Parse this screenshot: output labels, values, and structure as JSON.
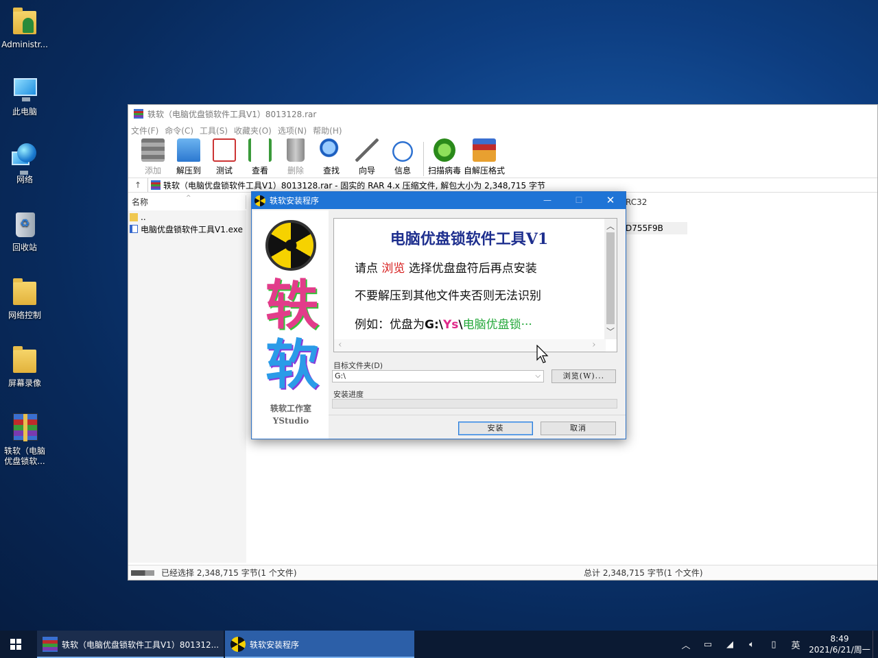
{
  "desktop": {
    "icons": [
      {
        "label": "Administr...",
        "type": "user-folder"
      },
      {
        "label": "此电脑",
        "type": "computer"
      },
      {
        "label": "网络",
        "type": "network"
      },
      {
        "label": "回收站",
        "type": "recycle-bin"
      },
      {
        "label": "网络控制",
        "type": "folder"
      },
      {
        "label": "屏幕录像",
        "type": "folder"
      },
      {
        "label": "轶软（电脑优盘锁软...",
        "type": "rar-archive"
      }
    ]
  },
  "winrar": {
    "title": "轶软（电脑优盘锁软件工具V1）8013128.rar",
    "menu": [
      "文件(F)",
      "命令(C)",
      "工具(S)",
      "收藏夹(O)",
      "选项(N)",
      "帮助(H)"
    ],
    "toolbar": {
      "add": "添加",
      "extract": "解压到",
      "test": "测试",
      "view": "查看",
      "delete": "删除",
      "find": "查找",
      "wizard": "向导",
      "info": "信息",
      "virus": "扫描病毒",
      "sfx": "自解压格式"
    },
    "address": "轶软（电脑优盘锁软件工具V1）8013128.rar - 固实的 RAR 4.x 压缩文件, 解包大小为 2,348,715 字节",
    "col_name": "名称",
    "col_crc": "RC32",
    "files": [
      {
        "name": ".."
      },
      {
        "name": "电脑优盘锁软件工具V1.exe",
        "crc": "D755F9B"
      }
    ],
    "status_left": "已经选择 2,348,715 字节(1 个文件)",
    "status_right": "总计 2,348,715 字节(1 个文件)"
  },
  "installer": {
    "title": "轶软安装程序",
    "brand_chars": [
      "轶",
      "软"
    ],
    "studio_cn": "轶软工作室",
    "studio_en": "YStudio",
    "heading": "电脑优盘锁软件工具V1",
    "line1_a": "请点",
    "line1_b": "浏览",
    "line1_c": "选择优盘盘符后再点安装",
    "line2": "不要解压到其他文件夹否则无法识别",
    "line3_a": "例如：优盘为",
    "line3_b": "G:\\",
    "line3_c": "Ys",
    "line3_d": "\\",
    "line3_e": "电脑优盘锁···",
    "target_label": "目标文件夹(D)",
    "target_value": "G:\\",
    "browse_button": "浏览(W)...",
    "progress_label": "安装进度",
    "install_button": "安装",
    "cancel_button": "取消",
    "progress": 0
  },
  "taskbar": {
    "task1": "轶软（电脑优盘锁软件工具V1）801312...",
    "task2": "轶软安装程序",
    "ime": "英",
    "time": "8:49",
    "date": "2021/6/21/周一"
  }
}
